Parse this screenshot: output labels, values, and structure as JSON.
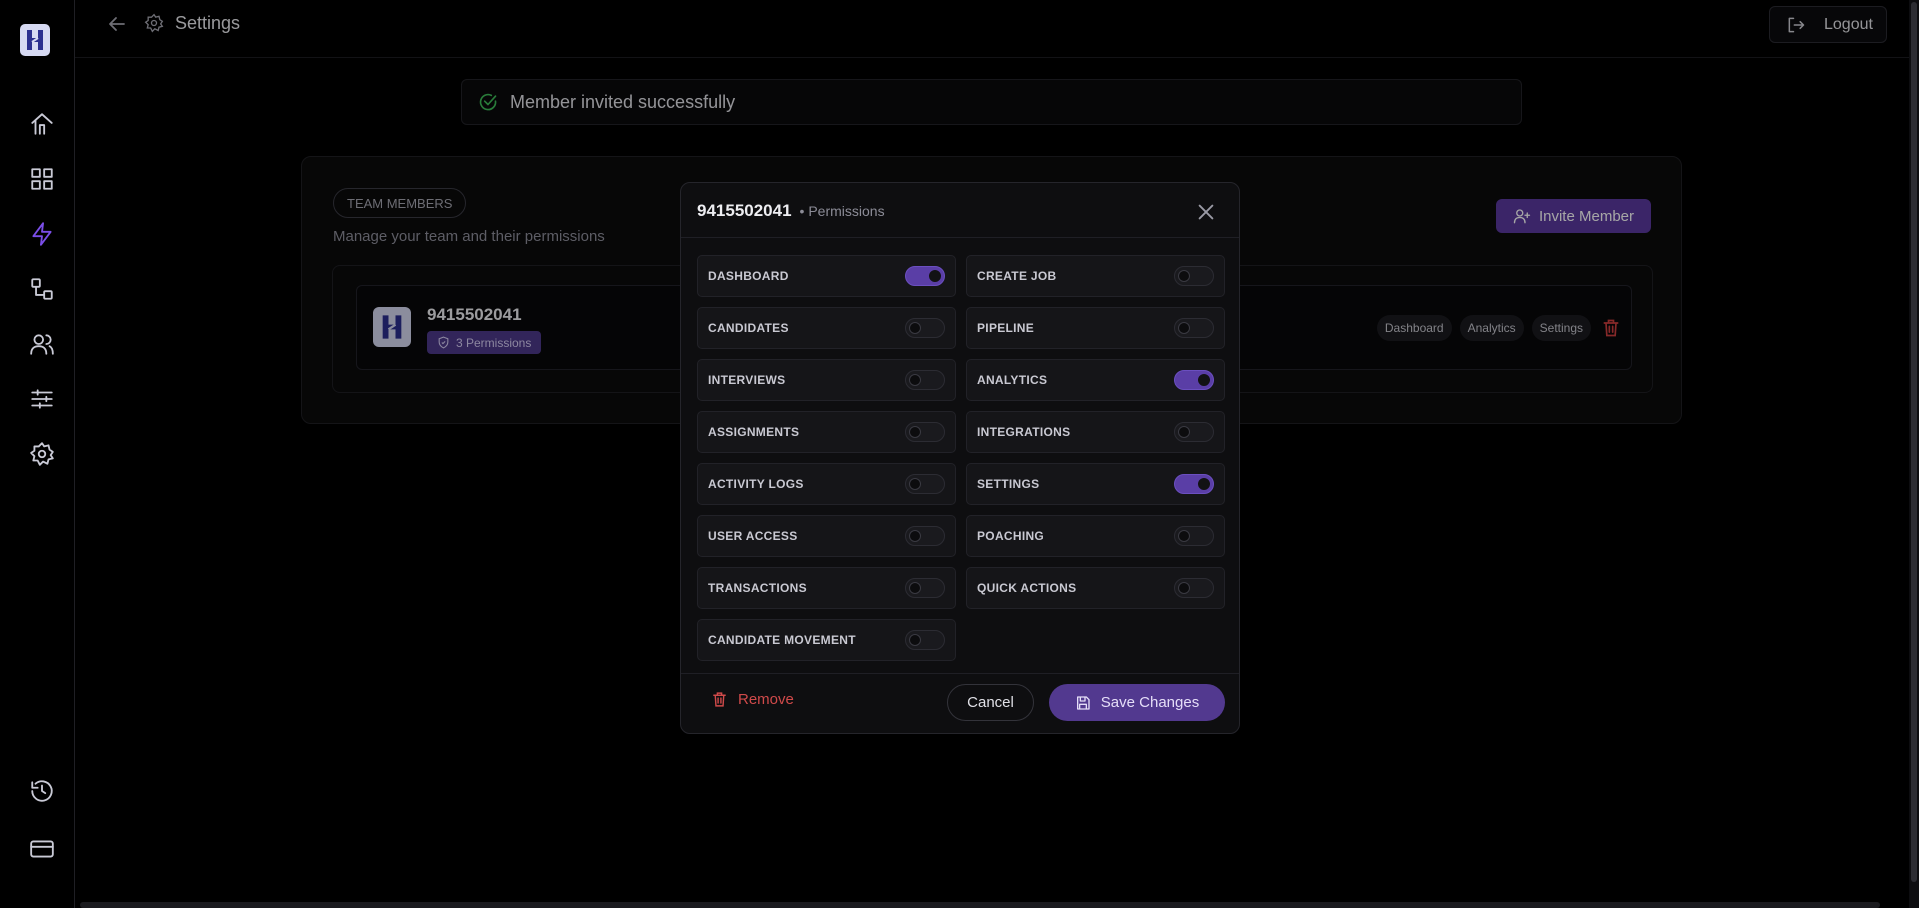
{
  "header": {
    "title": "Settings",
    "logout_label": "Logout"
  },
  "toast": {
    "message": "Member invited successfully"
  },
  "team": {
    "badge": "TEAM MEMBERS",
    "subtitle": "Manage your team and their permissions",
    "invite_label": "Invite Member",
    "member": {
      "name": "9415502041",
      "permissions_badge": "3 Permissions",
      "tags": [
        "Dashboard",
        "Analytics",
        "Settings"
      ]
    }
  },
  "modal": {
    "name": "9415502041",
    "subtitle": "• Permissions",
    "permissions": [
      {
        "label": "DASHBOARD",
        "enabled": true
      },
      {
        "label": "CREATE JOB",
        "enabled": false
      },
      {
        "label": "CANDIDATES",
        "enabled": false
      },
      {
        "label": "PIPELINE",
        "enabled": false
      },
      {
        "label": "INTERVIEWS",
        "enabled": false
      },
      {
        "label": "ANALYTICS",
        "enabled": true
      },
      {
        "label": "ASSIGNMENTS",
        "enabled": false
      },
      {
        "label": "INTEGRATIONS",
        "enabled": false
      },
      {
        "label": "ACTIVITY LOGS",
        "enabled": false
      },
      {
        "label": "SETTINGS",
        "enabled": true
      },
      {
        "label": "USER ACCESS",
        "enabled": false
      },
      {
        "label": "POACHING",
        "enabled": false
      },
      {
        "label": "TRANSACTIONS",
        "enabled": false
      },
      {
        "label": "QUICK ACTIONS",
        "enabled": false
      },
      {
        "label": "CANDIDATE MOVEMENT",
        "enabled": false
      }
    ],
    "remove_label": "Remove",
    "cancel_label": "Cancel",
    "save_label": "Save Changes"
  },
  "colors": {
    "accent": "#5b3aa0",
    "active_nav": "#7b4ee8",
    "danger": "#d04a4a",
    "success": "#3fbf5a"
  }
}
